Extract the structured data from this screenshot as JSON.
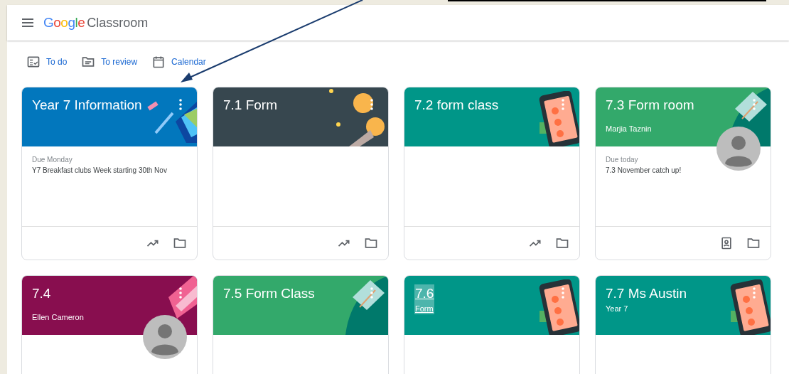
{
  "app": {
    "brand_google": "Google",
    "brand_product": "Classroom"
  },
  "nav": [
    {
      "kind": "todo",
      "label": "To do"
    },
    {
      "kind": "review",
      "label": "To review"
    },
    {
      "kind": "calendar",
      "label": "Calendar"
    }
  ],
  "cards": [
    {
      "title": "Year 7 Information",
      "color": "#0277bd",
      "art": {
        "kind": "pencils"
      },
      "highlighted": false,
      "avatar": false,
      "due": "Due Monday",
      "assignment": "Y7 Breakfast clubs Week starting 30th Nov",
      "footer": [
        {
          "kind": "trend"
        },
        {
          "kind": "folder"
        }
      ]
    },
    {
      "title": "7.1 Form",
      "color": "#37474f",
      "art": {
        "kind": "coins"
      },
      "highlighted": false,
      "avatar": false,
      "footer": [
        {
          "kind": "trend"
        },
        {
          "kind": "folder"
        }
      ]
    },
    {
      "title": "7.2 form class",
      "color": "#009688",
      "art": {
        "kind": "phone"
      },
      "highlighted": false,
      "avatar": false,
      "footer": [
        {
          "kind": "trend"
        },
        {
          "kind": "folder"
        }
      ]
    },
    {
      "title": "7.3 Form room",
      "subtitle": "Marjia Taznin",
      "color": "#33a96b",
      "art": {
        "kind": "book"
      },
      "highlighted": false,
      "avatar": true,
      "due": "Due today",
      "assignment": "7.3 November catch up!",
      "footer": [
        {
          "kind": "portfolio"
        },
        {
          "kind": "folder"
        }
      ]
    },
    {
      "title": "7.4",
      "subtitle": "Ellen Cameron",
      "color": "#880e4f",
      "art": {
        "kind": "tickets"
      },
      "highlighted": false,
      "avatar": true
    },
    {
      "title": "7.5 Form Class",
      "color": "#33a96b",
      "art": {
        "kind": "book"
      },
      "highlighted": false,
      "avatar": false
    },
    {
      "title": "7.6",
      "subtitle": "Form",
      "color": "#009688",
      "art": {
        "kind": "phone"
      },
      "highlighted": true,
      "avatar": false
    },
    {
      "title": "7.7 Ms Austin",
      "subtitle": "Year 7",
      "color": "#009688",
      "art": {
        "kind": "phone"
      },
      "highlighted": false,
      "avatar": false
    }
  ]
}
